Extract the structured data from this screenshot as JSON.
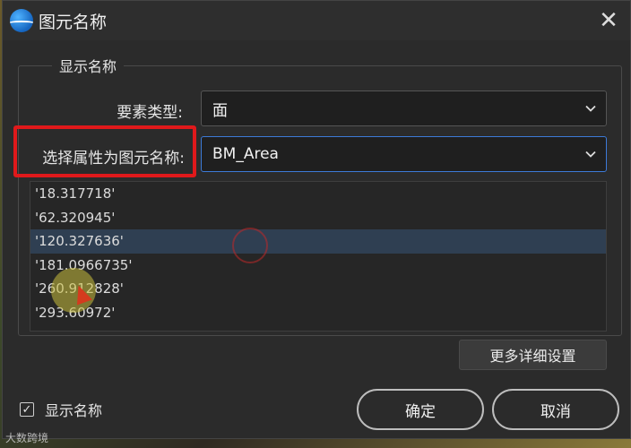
{
  "dialog": {
    "title": "图元名称",
    "close_label": "✕"
  },
  "group": {
    "title": "显示名称"
  },
  "feature_type": {
    "label": "要素类型:",
    "value": "面"
  },
  "attribute": {
    "label": "选择属性为图元名称:",
    "value": "BM_Area"
  },
  "values_list": [
    "'18.317718'",
    "'62.320945'",
    "'120.327636'",
    "'181.0966735'",
    "'260.912828'",
    "'293.60972'"
  ],
  "selected_index": 2,
  "advanced_button": "更多详细设置",
  "show_name_checkbox": {
    "label": "显示名称",
    "checked": true,
    "mark": "✓"
  },
  "buttons": {
    "ok": "确定",
    "cancel": "取消"
  },
  "watermark": "大数跨境",
  "colors": {
    "highlight": "#e0191b",
    "selection": "#2f3f52"
  }
}
